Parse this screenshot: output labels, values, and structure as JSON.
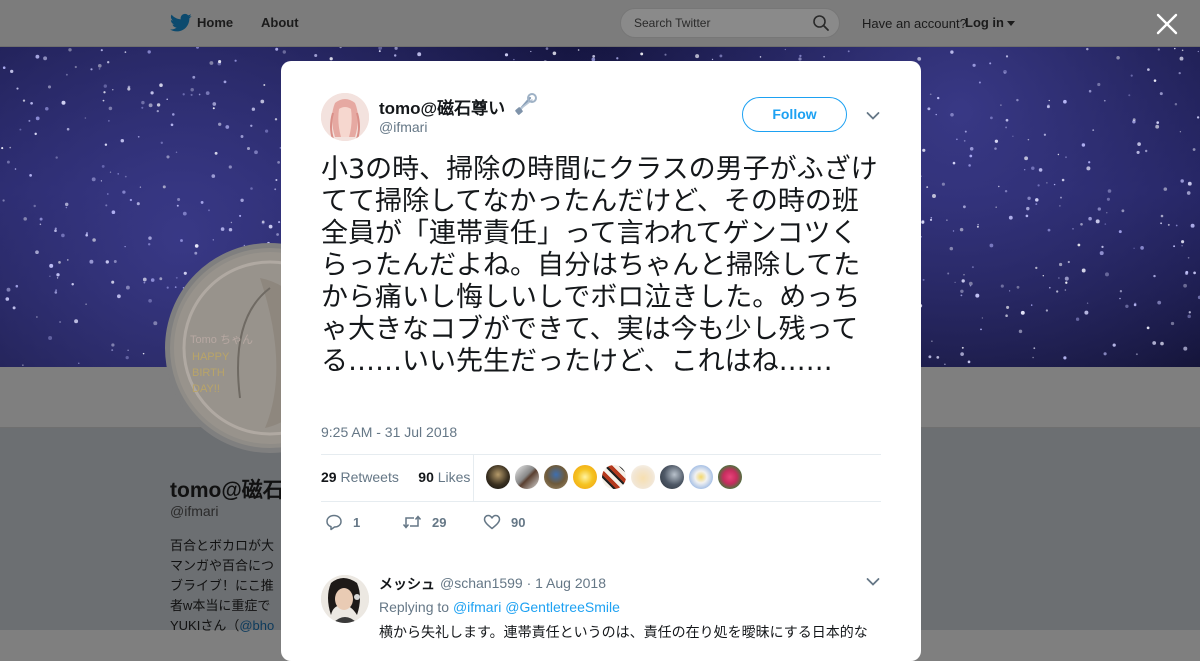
{
  "topbar": {
    "home_label": "Home",
    "about_label": "About",
    "search_placeholder": "Search Twitter",
    "have_account": "Have an account?",
    "login_label": "Log in"
  },
  "profile": {
    "name": "tomo@磁石",
    "handle": "@ifmari",
    "avatar_text": [
      "Tomo ちゃん",
      "HAPPY",
      "BIRTH",
      "DAY!!"
    ],
    "bio_lines": [
      "百合とボカロが大",
      "マンガや百合につ",
      "ブライブ！にこ推",
      "者w本当に重症で"
    ],
    "bio_last_prefix": "YUKIさん（",
    "bio_last_link": "@bho"
  },
  "tweet": {
    "author_name": "tomo@磁石尊い",
    "author_handle": "@ifmari",
    "follow_label": "Follow",
    "text": "小3の時、掃除の時間にクラスの男子がふざけてて掃除してなかったんだけど、その時の班全員が「連帯責任」って言われてゲンコツくらったんだよね。自分はちゃんと掃除してたから痛いし悔しいしでボロ泣きした。めっちゃ大きなコブができて、実は今も少し残ってる……いい先生だったけど、これはね……",
    "timestamp": "9:25 AM - 31 Jul 2018",
    "retweets_count": "29",
    "retweets_label": "Retweets",
    "likes_count": "90",
    "likes_label": "Likes",
    "actions": {
      "reply_count": "1",
      "retweet_count": "29",
      "like_count": "90"
    }
  },
  "reply": {
    "name": "メッシュ",
    "meta": "@schan1599 · 1 Aug 2018",
    "replying_to_label": "Replying to",
    "mention_1": "@ifmari",
    "mention_2": "@GentletreeSmile",
    "text": "横から失礼します。連帯責任というのは、責任の在り処を曖昧にする日本的な"
  },
  "colors": {
    "accent": "#1da1f2",
    "text_primary": "#14171a",
    "text_secondary": "#657786",
    "overlay_gray": "#7f7f7f"
  },
  "icons": [
    "twitter-bird-icon",
    "search-icon",
    "close-icon",
    "safety-pin-icon",
    "chevron-down-icon",
    "reply-icon",
    "retweet-icon",
    "like-icon"
  ]
}
